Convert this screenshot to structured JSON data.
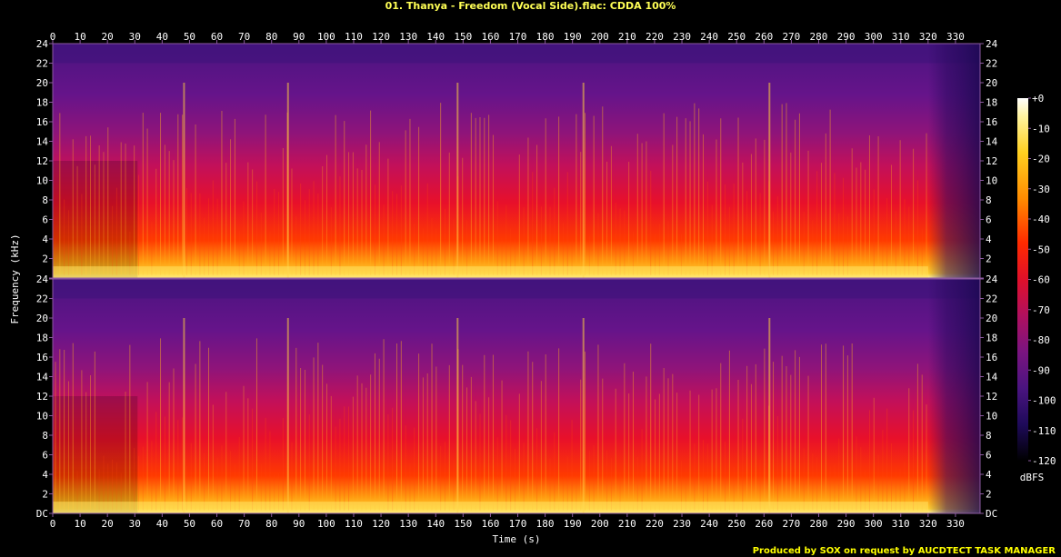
{
  "title": "01. Thanya - Freedom (Vocal Side).flac: CDDA 100%",
  "footer": "Produced by SOX on request by AUCDTECT TASK MANAGER",
  "chart_data": {
    "type": "heatmap",
    "title": "01. Thanya - Freedom (Vocal Side).flac: CDDA 100%",
    "xlabel": "Time (s)",
    "ylabel": "Frequency (kHz)",
    "xlim": [
      0,
      339
    ],
    "ylim": [
      0,
      24
    ],
    "x_ticks": [
      0,
      10,
      20,
      30,
      40,
      50,
      60,
      70,
      80,
      90,
      100,
      110,
      120,
      130,
      140,
      150,
      160,
      170,
      180,
      190,
      200,
      210,
      220,
      230,
      240,
      250,
      260,
      270,
      280,
      290,
      300,
      310,
      320,
      330
    ],
    "y_ticks": [
      "DC",
      "2",
      "4",
      "6",
      "8",
      "10",
      "12",
      "14",
      "16",
      "18",
      "20",
      "22",
      "24"
    ],
    "channels": 2,
    "colorbar": {
      "label": "dBFS",
      "range": [
        -120,
        0
      ],
      "ticks": [
        "+0",
        "-10",
        "-20",
        "-30",
        "-40",
        "-50",
        "-60",
        "-70",
        "-80",
        "-90",
        "-100",
        "-110",
        "-120"
      ]
    },
    "features": {
      "track_end_seconds": 320,
      "quiet_intro_seconds": 31,
      "lowpass_cutoff_khz": 22,
      "notable_transients_seconds": [
        48,
        86,
        148,
        194,
        262
      ]
    }
  },
  "colors": {
    "background": "#000000",
    "title": "#ffff55",
    "footer": "#ffff00",
    "axis": "#8c5aa0"
  }
}
